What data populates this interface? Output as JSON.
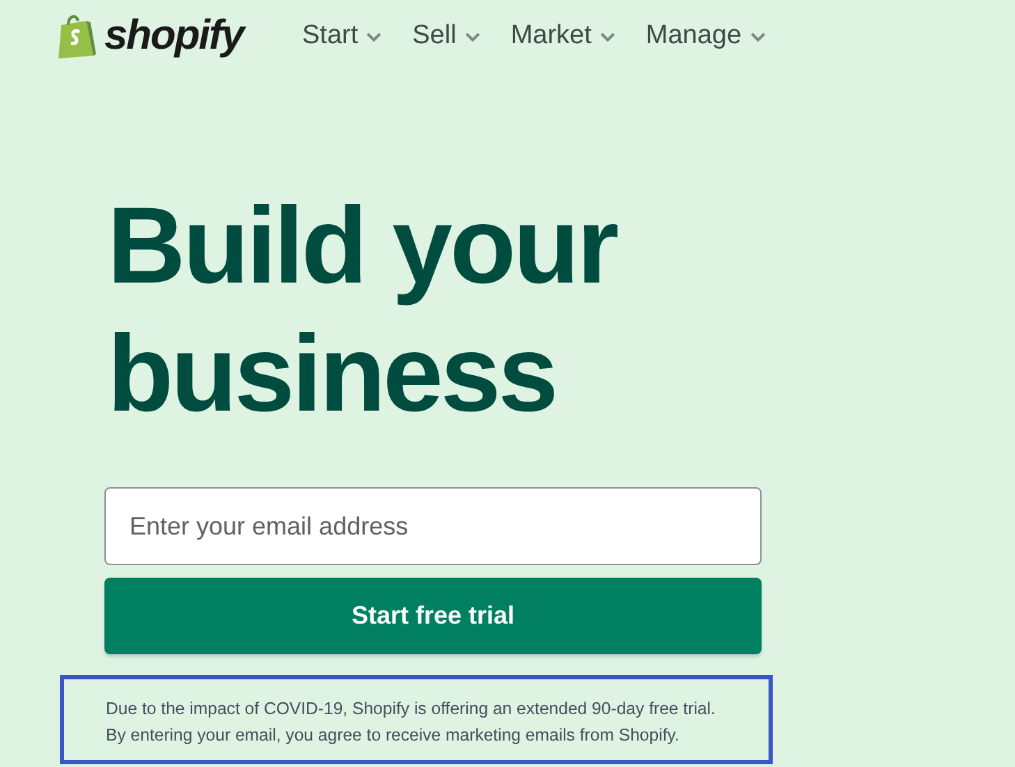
{
  "brand": {
    "name": "shopify"
  },
  "nav": [
    {
      "label": "Start"
    },
    {
      "label": "Sell"
    },
    {
      "label": "Market"
    },
    {
      "label": "Manage"
    }
  ],
  "hero": {
    "title_lines": [
      "Build your",
      "business"
    ]
  },
  "signup": {
    "placeholder": "Enter your email address",
    "button": "Start free trial"
  },
  "notice": {
    "text": "Due to the impact of COVID-19, Shopify is offering an extended 90-day free trial. By entering your email, you agree to receive marketing emails from Shopify.",
    "highlighted": true
  }
}
